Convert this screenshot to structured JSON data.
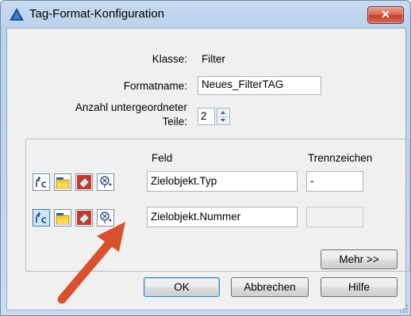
{
  "window": {
    "title": "Tag-Format-Konfiguration",
    "close_glyph": "✕"
  },
  "form": {
    "klasse_label": "Klasse:",
    "klasse_value": "Filter",
    "formatname_label": "Formatname:",
    "formatname_value": "Neues_FilterTAG",
    "anzahl_label_line1": "Anzahl untergeordneter",
    "anzahl_label_line2": "Teile:",
    "anzahl_value": "2"
  },
  "parts": {
    "col_feld": "Feld",
    "col_trennzeichen": "Trennzeichen",
    "rows": [
      {
        "feld": "Zielobjekt.Typ",
        "trennzeichen": "-"
      },
      {
        "feld": "Zielobjekt.Nummer",
        "trennzeichen": ""
      }
    ],
    "icons": [
      "formula-icon",
      "folder-icon",
      "paint-bucket-icon",
      "property-picker-icon"
    ]
  },
  "buttons": {
    "mehr": "Mehr >>",
    "ok": "OK",
    "abbrechen": "Abbrechen",
    "hilfe": "Hilfe"
  },
  "annotation": {
    "arrow_color": "#d9502e"
  }
}
